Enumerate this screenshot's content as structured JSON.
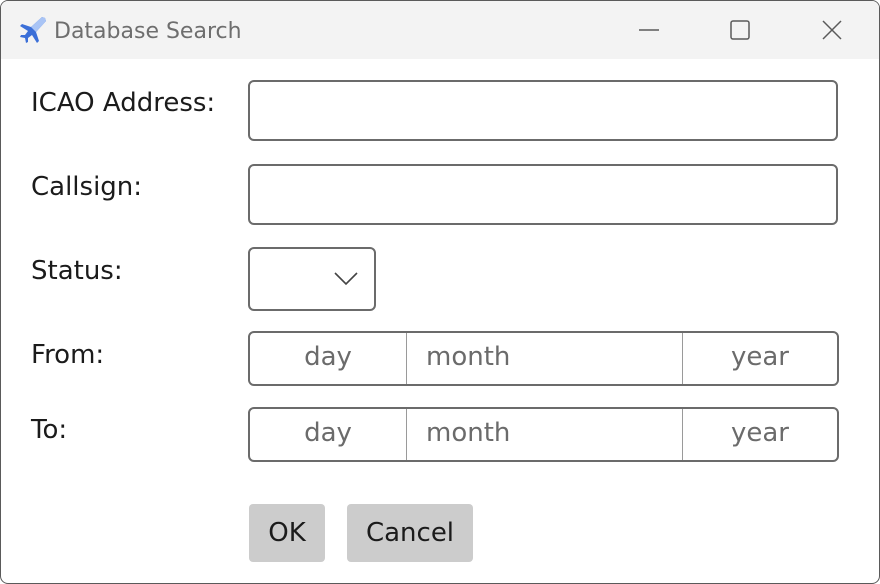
{
  "window": {
    "title": "Database Search",
    "icon": "airplane-icon",
    "controls": [
      "minimize-icon",
      "maximize-icon",
      "close-icon"
    ]
  },
  "form": {
    "icao": {
      "label": "ICAO Address:",
      "value": ""
    },
    "callsign": {
      "label": "Callsign:",
      "value": ""
    },
    "status": {
      "label": "Status:",
      "selected": ""
    },
    "from": {
      "label": "From:",
      "day": "day",
      "month": "month",
      "year": "year"
    },
    "to": {
      "label": "To:",
      "day": "day",
      "month": "month",
      "year": "year"
    }
  },
  "buttons": {
    "ok": "OK",
    "cancel": "Cancel"
  },
  "colors": {
    "titlebar": "#f3f3f3",
    "border": "#6b6b6b",
    "button": "#cccccc",
    "icon_blue": "#3b6fd8"
  }
}
